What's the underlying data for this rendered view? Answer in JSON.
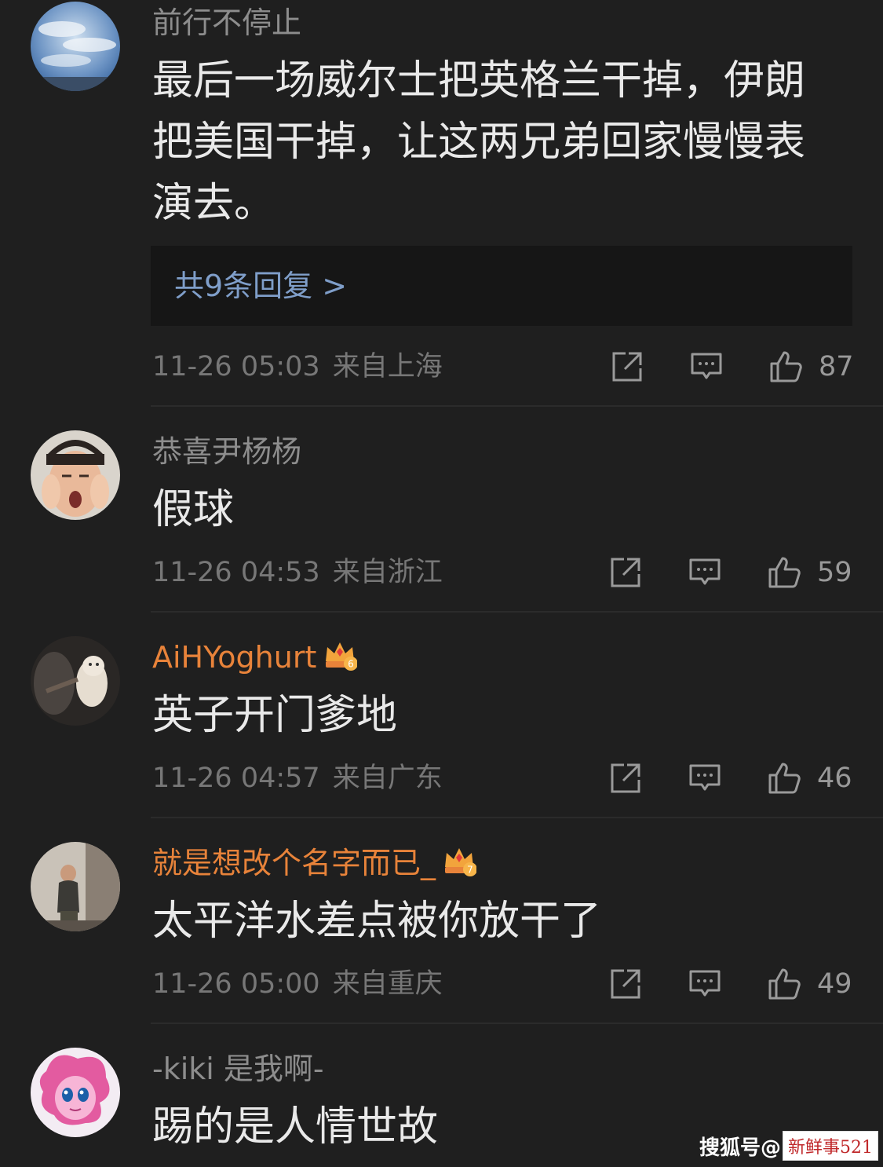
{
  "comments": [
    {
      "username": "前行不停止",
      "content": "最后一场威尔士把英格兰干掉，伊朗把美国干掉，让这两兄弟回家慢慢表演去。",
      "replies_label": "共9条回复 >",
      "time": "11-26 05:03",
      "location": "来自上海",
      "likes": "87"
    },
    {
      "username": "恭喜尹杨杨",
      "content": "假球",
      "time": "11-26 04:53",
      "location": "来自浙江",
      "likes": "59"
    },
    {
      "username": "AiHYoghurt",
      "vip_level": "6",
      "content": "英子开门爹地",
      "time": "11-26 04:57",
      "location": "来自广东",
      "likes": "46"
    },
    {
      "username": "就是想改个名字而已_",
      "vip_level": "7",
      "content": "太平洋水差点被你放干了",
      "time": "11-26 05:00",
      "location": "来自重庆",
      "likes": "49"
    },
    {
      "username": "-kiki 是我啊-",
      "content": "踢的是人情世故"
    }
  ],
  "watermark": {
    "platform": "搜狐号@",
    "account": "新鲜事521"
  },
  "colors": {
    "background": "#1f1f1f",
    "username": "#8d8d8d",
    "vip_username": "#e8833a",
    "reply_link": "#7f9ec9",
    "content": "#e9e9e9"
  },
  "icons": [
    "share-icon",
    "comment-icon",
    "thumbs-up-icon",
    "vip-crown-icon"
  ]
}
